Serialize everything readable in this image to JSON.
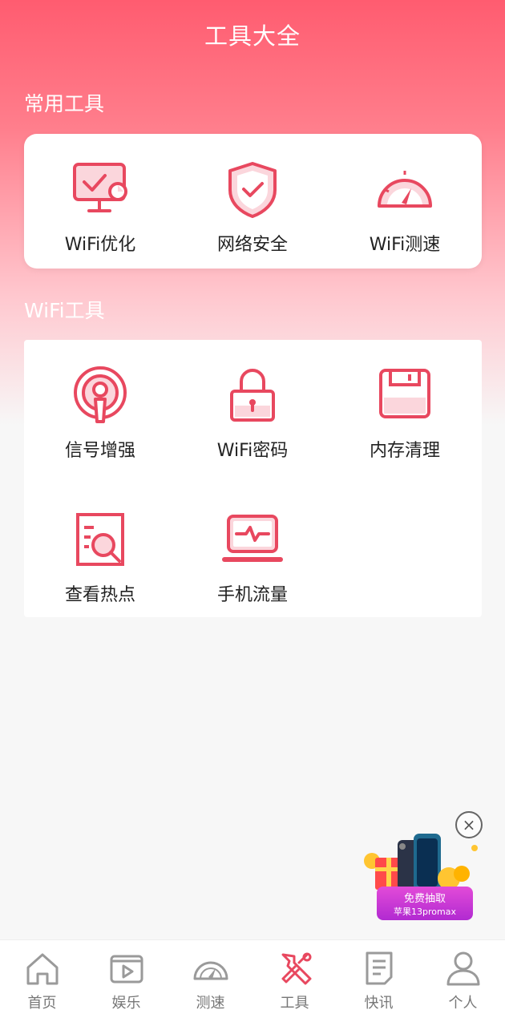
{
  "header": {
    "title": "工具大全"
  },
  "sections": {
    "common": {
      "label": "常用工具",
      "items": [
        {
          "label": "WiFi优化",
          "icon": "monitor-check-icon"
        },
        {
          "label": "网络安全",
          "icon": "shield-check-icon"
        },
        {
          "label": "WiFi测速",
          "icon": "speedometer-icon"
        }
      ]
    },
    "wifi": {
      "label": "WiFi工具",
      "items": [
        {
          "label": "信号增强",
          "icon": "signal-broadcast-icon"
        },
        {
          "label": "WiFi密码",
          "icon": "lock-icon"
        },
        {
          "label": "内存清理",
          "icon": "floppy-disk-icon"
        },
        {
          "label": "查看热点",
          "icon": "document-search-icon"
        },
        {
          "label": "手机流量",
          "icon": "laptop-pulse-icon"
        }
      ]
    }
  },
  "promo": {
    "line1": "免费抽取",
    "line2": "苹果13promax",
    "close": "×"
  },
  "nav": {
    "items": [
      {
        "label": "首页",
        "icon": "home-icon"
      },
      {
        "label": "娱乐",
        "icon": "play-icon"
      },
      {
        "label": "测速",
        "icon": "speedometer-icon"
      },
      {
        "label": "工具",
        "icon": "tools-icon"
      },
      {
        "label": "快讯",
        "icon": "news-icon"
      },
      {
        "label": "个人",
        "icon": "person-icon"
      }
    ],
    "active_index": 3
  },
  "colors": {
    "accent": "#e8485f",
    "accent_light": "#fbd6dc",
    "nav_gray": "#9a9a9a"
  }
}
